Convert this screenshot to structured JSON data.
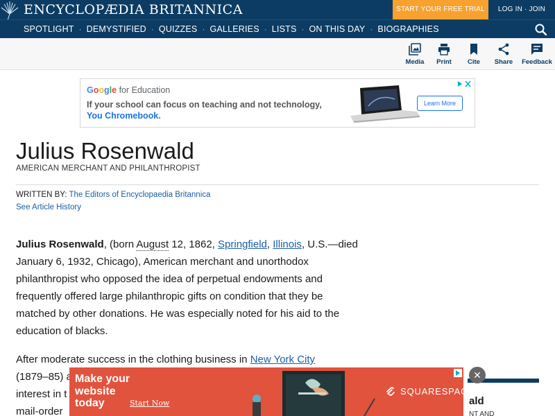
{
  "header": {
    "brand": "ENCYCLOPÆDIA BRITANNICA",
    "trial_label": "START YOUR FREE TRIAL",
    "login_label": "LOG IN · JOIN",
    "bg_color": "#0c3c63",
    "accent_color": "#f7a22e"
  },
  "nav": {
    "items": [
      "SPOTLIGHT",
      "DEMYSTIFIED",
      "QUIZZES",
      "GALLERIES",
      "LISTS",
      "ON THIS DAY",
      "BIOGRAPHIES"
    ],
    "separator": "·",
    "search_icon": "search-icon"
  },
  "toolbar": {
    "items": [
      {
        "label": "Media",
        "icon": "media-icon"
      },
      {
        "label": "Print",
        "icon": "print-icon"
      },
      {
        "label": "Cite",
        "icon": "bookmark-icon"
      },
      {
        "label": "Share",
        "icon": "share-icon"
      },
      {
        "label": "Feedback",
        "icon": "feedback-icon"
      }
    ]
  },
  "top_ad": {
    "google": "Google",
    "brand_suffix": "for Education",
    "line1": "If your school can focus on teaching and not technology,",
    "line2": "You Chromebook.",
    "cta": "Learn More"
  },
  "article": {
    "title": "Julius Rosenwald",
    "subtitle": "AMERICAN MERCHANT AND PHILANTHROPIST",
    "written_by_label": "WRITTEN BY:",
    "author": "The Editors of Encyclopaedia Britannica",
    "history_link": "See Article History",
    "p1": {
      "name": "Julius Rosenwald",
      "t1": ", (born ",
      "dict_word": "August",
      "t2": " 12, 1862, ",
      "link1": "Springfield",
      "t3": ", ",
      "link2": "Illinois",
      "t4": ", U.S.—died",
      "lines": [
        "January 6, 1932, Chicago), American merchant and unorthodox",
        "philanthropist who opposed the idea of perpetual endowments and",
        "frequently offered large philanthropic gifts on condition that they be",
        "matched by other donations. He was especially noted for his aid to the",
        "education of blacks."
      ]
    },
    "p2": {
      "t1": "After moderate success in the clothing business in ",
      "link": "New York City",
      "line2": "(1879–85) a",
      "line3": "interest in t",
      "line4": "mail-order"
    }
  },
  "side_box": {
    "title": "ald",
    "subtitle": "NT AND"
  },
  "bottom_ad": {
    "headline_1": "Make your",
    "headline_2": "website",
    "headline_3": "today",
    "cta": "Start Now",
    "brand": "SQUARESPACE",
    "close": "✕",
    "bg_color": "#e1533d"
  }
}
